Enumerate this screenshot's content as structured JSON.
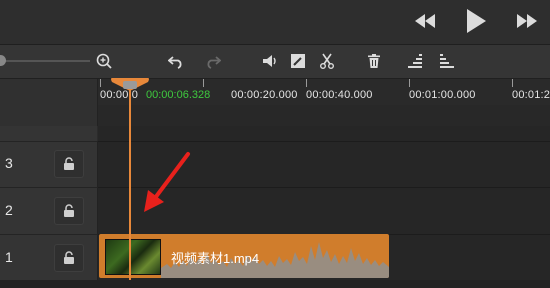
{
  "transport": {
    "rewind_icon": "rewind-icon",
    "play_icon": "play-icon",
    "forward_icon": "fast-forward-icon"
  },
  "toolbar": {
    "icons": [
      "zoom-in-icon",
      "undo-icon",
      "redo-icon",
      "volume-icon",
      "edit-icon",
      "cut-icon",
      "delete-icon",
      "audio-bars-icon",
      "audio-levels-icon"
    ]
  },
  "ruler": {
    "labels": [
      "00:00:0",
      "00:00:20.000",
      "00:00:40.000",
      "00:01:00.000",
      "00:01:2"
    ],
    "current_time": "00:00:06.328"
  },
  "tracks": [
    {
      "number": "3"
    },
    {
      "number": "2"
    },
    {
      "number": "1"
    }
  ],
  "clip": {
    "name": "视频素材1.mp4"
  },
  "colors": {
    "accent": "#e8883a",
    "clip": "#d07d2c",
    "time_green": "#3ec93e"
  }
}
